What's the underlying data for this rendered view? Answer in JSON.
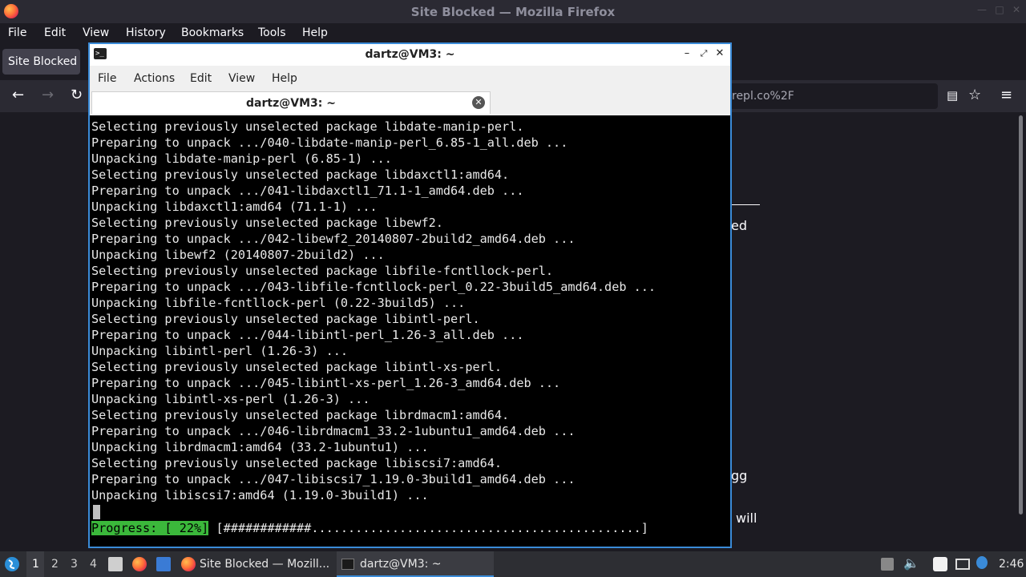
{
  "firefox": {
    "window_title": "Site Blocked — Mozilla Firefox",
    "menu": [
      "File",
      "Edit",
      "View",
      "History",
      "Bookmarks",
      "Tools",
      "Help"
    ],
    "tab_title": "Site Blocked",
    "url_fragment": "repl.co%2F",
    "content_fragments": [
      "ed",
      "gg",
      "will"
    ]
  },
  "terminal": {
    "window_title": "dartz@VM3: ~",
    "menu": [
      "File",
      "Actions",
      "Edit",
      "View",
      "Help"
    ],
    "tab_label": "dartz@VM3: ~",
    "lines": [
      "Selecting previously unselected package libdate-manip-perl.",
      "Preparing to unpack .../040-libdate-manip-perl_6.85-1_all.deb ...",
      "Unpacking libdate-manip-perl (6.85-1) ...",
      "Selecting previously unselected package libdaxctl1:amd64.",
      "Preparing to unpack .../041-libdaxctl1_71.1-1_amd64.deb ...",
      "Unpacking libdaxctl1:amd64 (71.1-1) ...",
      "Selecting previously unselected package libewf2.",
      "Preparing to unpack .../042-libewf2_20140807-2build2_amd64.deb ...",
      "Unpacking libewf2 (20140807-2build2) ...",
      "Selecting previously unselected package libfile-fcntllock-perl.",
      "Preparing to unpack .../043-libfile-fcntllock-perl_0.22-3build5_amd64.deb ...",
      "Unpacking libfile-fcntllock-perl (0.22-3build5) ...",
      "Selecting previously unselected package libintl-perl.",
      "Preparing to unpack .../044-libintl-perl_1.26-3_all.deb ...",
      "Unpacking libintl-perl (1.26-3) ...",
      "Selecting previously unselected package libintl-xs-perl.",
      "Preparing to unpack .../045-libintl-xs-perl_1.26-3_amd64.deb ...",
      "Unpacking libintl-xs-perl (1.26-3) ...",
      "Selecting previously unselected package librdmacm1:amd64.",
      "Preparing to unpack .../046-librdmacm1_33.2-1ubuntu1_amd64.deb ...",
      "Unpacking librdmacm1:amd64 (33.2-1ubuntu1) ...",
      "Selecting previously unselected package libiscsi7:amd64.",
      "Preparing to unpack .../047-libiscsi7_1.19.0-3build1_amd64.deb ...",
      "Unpacking libiscsi7:amd64 (1.19.0-3build1) ..."
    ],
    "progress_label": "Progress: [ 22%]",
    "progress_bar": " [############.............................................]",
    "progress_fraction": 0.22
  },
  "taskbar": {
    "workspaces": [
      "1",
      "2",
      "3",
      "4"
    ],
    "active_workspace": "1",
    "tasks": [
      "Site Blocked — Mozill...",
      "dartz@VM3: ~"
    ],
    "clock": "2:46"
  },
  "colors": {
    "terminal_accent": "#3a8bd8",
    "progress_green": "#3bb83b",
    "firefox_bg": "#1c1b22"
  }
}
